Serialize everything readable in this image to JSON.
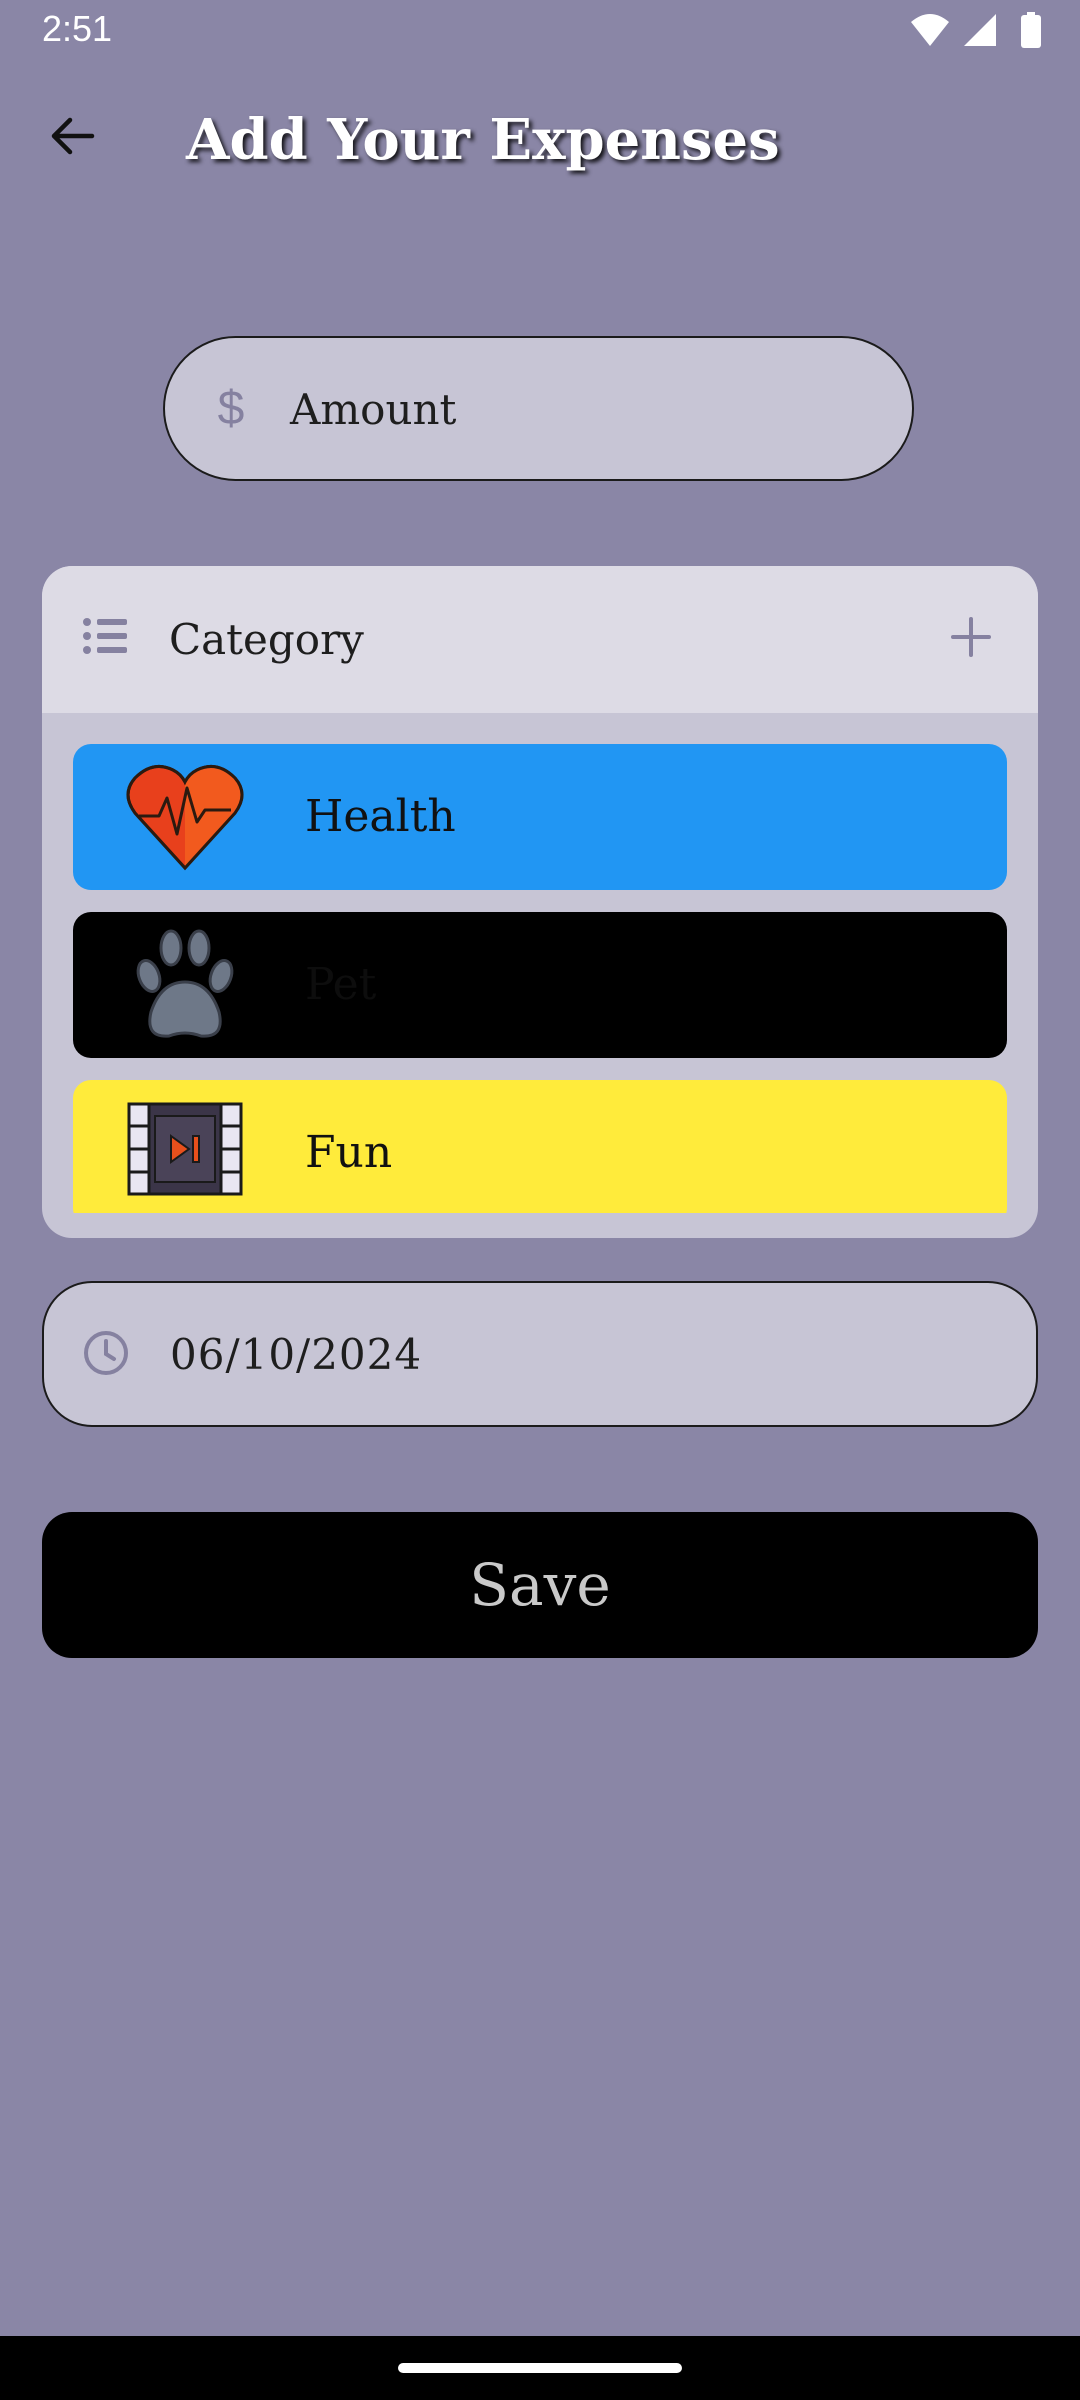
{
  "status_bar": {
    "time": "2:51"
  },
  "header": {
    "title": "Add Your Expenses"
  },
  "amount_field": {
    "placeholder": "Amount"
  },
  "category": {
    "label": "Category",
    "items": [
      {
        "name": "Health",
        "icon": "heart-pulse-icon",
        "background": "#2196f3",
        "text_color": "#111111"
      },
      {
        "name": "Pet",
        "icon": "paw-icon",
        "background": "#000000",
        "text_color": "#0d0d0d"
      },
      {
        "name": "Fun",
        "icon": "film-icon",
        "background": "#ffeb3b",
        "text_color": "#111111"
      }
    ]
  },
  "date_field": {
    "value": "06/10/2024"
  },
  "save_button": {
    "label": "Save"
  },
  "colors": {
    "background": "#8a86a6",
    "field": "#c7c5d5",
    "category_header": "#dddbe5",
    "accent_icon": "#8581a0",
    "save_button": "#000000"
  }
}
